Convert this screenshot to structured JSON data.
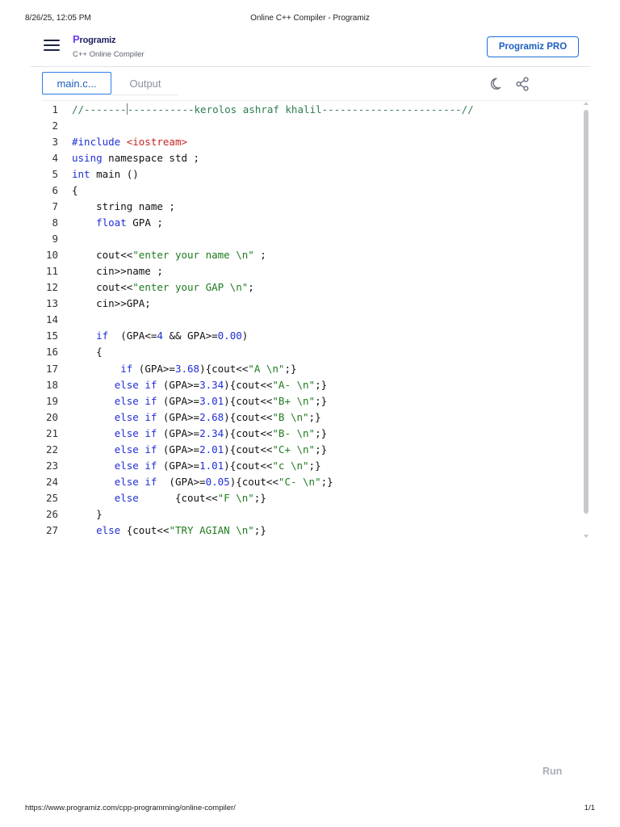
{
  "print_header": {
    "datetime": "8/26/25, 12:05 PM",
    "page_title": "Online C++ Compiler - Programiz"
  },
  "topbar": {
    "menu_icon": "hamburger-menu-icon",
    "logo_p": "P",
    "logo_rest": "rogramiz",
    "logo_subtitle": "C++ Online Compiler",
    "pro_button": "Programiz PRO"
  },
  "tabs": {
    "main_file": "main.c...",
    "output": "Output",
    "theme_icon": "moon-icon",
    "share_icon": "share-icon"
  },
  "colors": {
    "accent": "#2d7de8",
    "keyword": "#1f2fd6",
    "string": "#1f7a1f",
    "comment": "#2e7d4f",
    "include": "#c82323"
  },
  "code_lines": [
    {
      "n": "1",
      "tokens": [
        {
          "t": "c",
          "v": "//-------"
        },
        {
          "t": "cursor",
          "v": ""
        },
        {
          "t": "c",
          "v": "-----------kerolos ashraf khalil-----------------------//"
        }
      ]
    },
    {
      "n": "2",
      "tokens": []
    },
    {
      "n": "3",
      "tokens": [
        {
          "t": "k",
          "v": "#include "
        },
        {
          "t": "i",
          "v": "<iostream>"
        }
      ]
    },
    {
      "n": "4",
      "tokens": [
        {
          "t": "k",
          "v": "using"
        },
        {
          "t": "p",
          "v": " namespace std ;"
        }
      ]
    },
    {
      "n": "5",
      "tokens": [
        {
          "t": "k",
          "v": "int"
        },
        {
          "t": "p",
          "v": " main ()"
        }
      ]
    },
    {
      "n": "6",
      "tokens": [
        {
          "t": "p",
          "v": "{"
        }
      ]
    },
    {
      "n": "7",
      "tokens": [
        {
          "t": "p",
          "v": "    string name ;"
        }
      ]
    },
    {
      "n": "8",
      "tokens": [
        {
          "t": "p",
          "v": "    "
        },
        {
          "t": "k",
          "v": "float"
        },
        {
          "t": "p",
          "v": " GPA ;"
        }
      ]
    },
    {
      "n": "9",
      "tokens": []
    },
    {
      "n": "10",
      "tokens": [
        {
          "t": "p",
          "v": "    cout<<"
        },
        {
          "t": "s",
          "v": "\"enter your name \\n\""
        },
        {
          "t": "p",
          "v": " ;"
        }
      ]
    },
    {
      "n": "11",
      "tokens": [
        {
          "t": "p",
          "v": "    cin>>name ;"
        }
      ]
    },
    {
      "n": "12",
      "tokens": [
        {
          "t": "p",
          "v": "    cout<<"
        },
        {
          "t": "s",
          "v": "\"enter your GAP \\n\""
        },
        {
          "t": "p",
          "v": ";"
        }
      ]
    },
    {
      "n": "13",
      "tokens": [
        {
          "t": "p",
          "v": "    cin>>GPA;"
        }
      ]
    },
    {
      "n": "14",
      "tokens": []
    },
    {
      "n": "15",
      "tokens": [
        {
          "t": "p",
          "v": "    "
        },
        {
          "t": "k",
          "v": "if"
        },
        {
          "t": "p",
          "v": "  (GPA<="
        },
        {
          "t": "n",
          "v": "4"
        },
        {
          "t": "p",
          "v": " && GPA>="
        },
        {
          "t": "n",
          "v": "0.00"
        },
        {
          "t": "p",
          "v": ")"
        }
      ]
    },
    {
      "n": "16",
      "tokens": [
        {
          "t": "p",
          "v": "    {"
        }
      ]
    },
    {
      "n": "17",
      "tokens": [
        {
          "t": "p",
          "v": "        "
        },
        {
          "t": "k",
          "v": "if"
        },
        {
          "t": "p",
          "v": " (GPA>="
        },
        {
          "t": "n",
          "v": "3.68"
        },
        {
          "t": "p",
          "v": "){cout<<"
        },
        {
          "t": "s",
          "v": "\"A \\n\""
        },
        {
          "t": "p",
          "v": ";}"
        }
      ]
    },
    {
      "n": "18",
      "tokens": [
        {
          "t": "p",
          "v": "       "
        },
        {
          "t": "k",
          "v": "else if"
        },
        {
          "t": "p",
          "v": " (GPA>="
        },
        {
          "t": "n",
          "v": "3.34"
        },
        {
          "t": "p",
          "v": "){cout<<"
        },
        {
          "t": "s",
          "v": "\"A- \\n\""
        },
        {
          "t": "p",
          "v": ";}"
        }
      ]
    },
    {
      "n": "19",
      "tokens": [
        {
          "t": "p",
          "v": "       "
        },
        {
          "t": "k",
          "v": "else if"
        },
        {
          "t": "p",
          "v": " (GPA>="
        },
        {
          "t": "n",
          "v": "3.01"
        },
        {
          "t": "p",
          "v": "){cout<<"
        },
        {
          "t": "s",
          "v": "\"B+ \\n\""
        },
        {
          "t": "p",
          "v": ";}"
        }
      ]
    },
    {
      "n": "20",
      "tokens": [
        {
          "t": "p",
          "v": "       "
        },
        {
          "t": "k",
          "v": "else if"
        },
        {
          "t": "p",
          "v": " (GPA>="
        },
        {
          "t": "n",
          "v": "2.68"
        },
        {
          "t": "p",
          "v": "){cout<<"
        },
        {
          "t": "s",
          "v": "\"B \\n\""
        },
        {
          "t": "p",
          "v": ";}"
        }
      ]
    },
    {
      "n": "21",
      "tokens": [
        {
          "t": "p",
          "v": "       "
        },
        {
          "t": "k",
          "v": "else if"
        },
        {
          "t": "p",
          "v": " (GPA>="
        },
        {
          "t": "n",
          "v": "2.34"
        },
        {
          "t": "p",
          "v": "){cout<<"
        },
        {
          "t": "s",
          "v": "\"B- \\n\""
        },
        {
          "t": "p",
          "v": ";}"
        }
      ]
    },
    {
      "n": "22",
      "tokens": [
        {
          "t": "p",
          "v": "       "
        },
        {
          "t": "k",
          "v": "else if"
        },
        {
          "t": "p",
          "v": " (GPA>="
        },
        {
          "t": "n",
          "v": "2.01"
        },
        {
          "t": "p",
          "v": "){cout<<"
        },
        {
          "t": "s",
          "v": "\"C+ \\n\""
        },
        {
          "t": "p",
          "v": ";}"
        }
      ]
    },
    {
      "n": "23",
      "tokens": [
        {
          "t": "p",
          "v": "       "
        },
        {
          "t": "k",
          "v": "else if"
        },
        {
          "t": "p",
          "v": " (GPA>="
        },
        {
          "t": "n",
          "v": "1.01"
        },
        {
          "t": "p",
          "v": "){cout<<"
        },
        {
          "t": "s",
          "v": "\"c \\n\""
        },
        {
          "t": "p",
          "v": ";}"
        }
      ]
    },
    {
      "n": "24",
      "tokens": [
        {
          "t": "p",
          "v": "       "
        },
        {
          "t": "k",
          "v": "else if"
        },
        {
          "t": "p",
          "v": "  (GPA>="
        },
        {
          "t": "n",
          "v": "0.05"
        },
        {
          "t": "p",
          "v": "){cout<<"
        },
        {
          "t": "s",
          "v": "\"C- \\n\""
        },
        {
          "t": "p",
          "v": ";}"
        }
      ]
    },
    {
      "n": "25",
      "tokens": [
        {
          "t": "p",
          "v": "       "
        },
        {
          "t": "k",
          "v": "else"
        },
        {
          "t": "p",
          "v": "      {cout<<"
        },
        {
          "t": "s",
          "v": "\"F \\n\""
        },
        {
          "t": "p",
          "v": ";}"
        }
      ]
    },
    {
      "n": "26",
      "tokens": [
        {
          "t": "p",
          "v": "    }"
        }
      ]
    },
    {
      "n": "27",
      "tokens": [
        {
          "t": "p",
          "v": "    "
        },
        {
          "t": "k",
          "v": "else"
        },
        {
          "t": "p",
          "v": " {cout<<"
        },
        {
          "t": "s",
          "v": "\"TRY AGIAN \\n\""
        },
        {
          "t": "p",
          "v": ";}"
        }
      ]
    }
  ],
  "run_button": "Run",
  "print_footer": {
    "url": "https://www.programiz.com/cpp-programming/online-compiler/",
    "page": "1/1"
  }
}
